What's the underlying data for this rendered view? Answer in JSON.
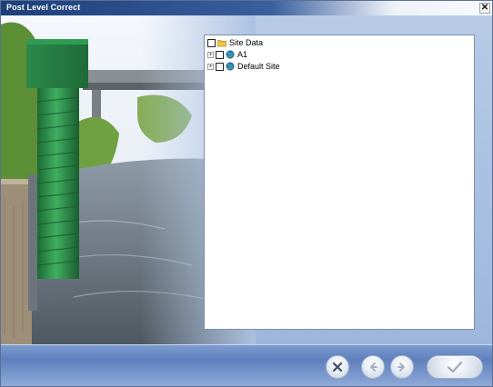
{
  "window": {
    "title": "Post Level Correct"
  },
  "tree": {
    "root": {
      "label": "Site Data"
    },
    "children": [
      {
        "label": "A1"
      },
      {
        "label": "Default Site"
      }
    ]
  },
  "icons": {
    "close": "close-icon",
    "cancel": "x-circle-icon",
    "back": "arrow-left-icon",
    "next": "arrow-right-icon",
    "finish": "checkmark-icon",
    "root": "folder-icon",
    "site": "globe-site-icon",
    "expander": "plus-expander-icon"
  },
  "colors": {
    "titlebar": "#1d3f7a",
    "footer": "#5f80bd",
    "panel": "#ffffff",
    "accent_green": "#2b8a49"
  }
}
